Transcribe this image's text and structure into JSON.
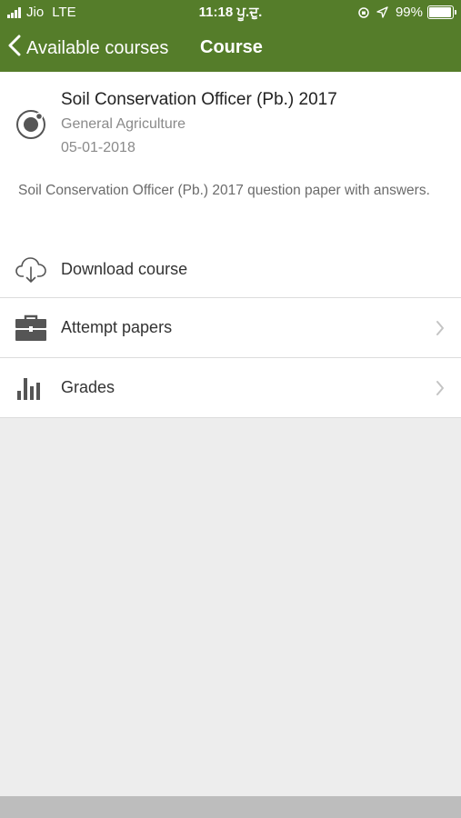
{
  "status_bar": {
    "carrier": "Jio",
    "network": "LTE",
    "time": "11:18 ਪੂ.ਦੁ.",
    "battery_percent": "99%",
    "battery_level": 0.99
  },
  "nav": {
    "back_label": "Available courses",
    "title": "Course"
  },
  "course": {
    "title": "Soil Conservation Officer (Pb.) 2017",
    "category": "General Agriculture",
    "date": "05-01-2018",
    "description": "Soil Conservation Officer (Pb.) 2017 question paper with answers."
  },
  "menu": [
    {
      "label": "Download course",
      "icon": "cloud-download-icon",
      "has_chevron": false
    },
    {
      "label": "Attempt papers",
      "icon": "briefcase-icon",
      "has_chevron": true
    },
    {
      "label": "Grades",
      "icon": "bar-chart-icon",
      "has_chevron": true
    }
  ],
  "colors": {
    "header": "#557d2a",
    "background": "#ededed",
    "card": "#ffffff"
  }
}
